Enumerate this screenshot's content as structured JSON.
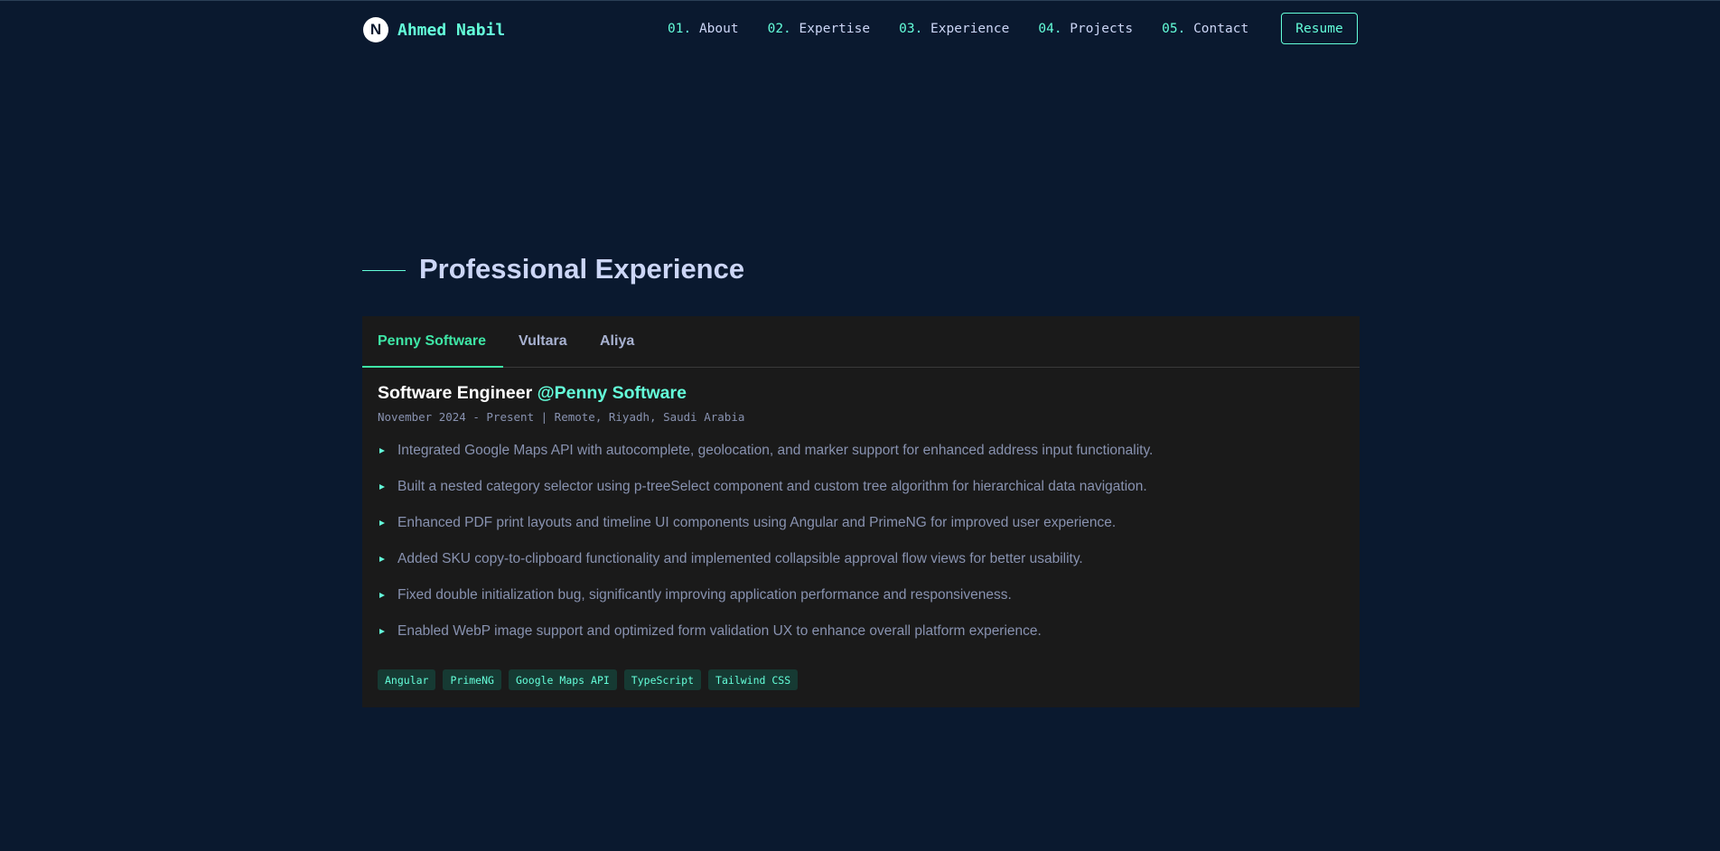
{
  "brand": {
    "logo_letter": "N",
    "name": "Ahmed Nabil"
  },
  "nav": {
    "links": [
      {
        "num": "01.",
        "label": "About"
      },
      {
        "num": "02.",
        "label": "Expertise"
      },
      {
        "num": "03.",
        "label": "Experience"
      },
      {
        "num": "04.",
        "label": "Projects"
      },
      {
        "num": "05.",
        "label": "Contact"
      }
    ],
    "resume_label": "Resume"
  },
  "section": {
    "title": "Professional Experience"
  },
  "experience": {
    "tabs": [
      "Penny Software",
      "Vultara",
      "Aliya"
    ],
    "active_tab": "Penny Software",
    "role": "Software Engineer",
    "company": "@Penny Software",
    "meta": "November 2024 - Present | Remote, Riyadh, Saudi Arabia",
    "bullets": [
      "Integrated Google Maps API with autocomplete, geolocation, and marker support for enhanced address input functionality.",
      "Built a nested category selector using p-treeSelect component and custom tree algorithm for hierarchical data navigation.",
      "Enhanced PDF print layouts and timeline UI components using Angular and PrimeNG for improved user experience.",
      "Added SKU copy-to-clipboard functionality and implemented collapsible approval flow views for better usability.",
      "Fixed double initialization bug, significantly improving application performance and responsiveness.",
      "Enabled WebP image support and optimized form validation UX to enhance overall platform experience."
    ],
    "tags": [
      "Angular",
      "PrimeNG",
      "Google Maps API",
      "TypeScript",
      "Tailwind CSS"
    ]
  },
  "colors": {
    "background": "#0a192f",
    "accent": "#64ffda",
    "card": "#1a1a1a",
    "active_tab": "#3ee6a6"
  }
}
